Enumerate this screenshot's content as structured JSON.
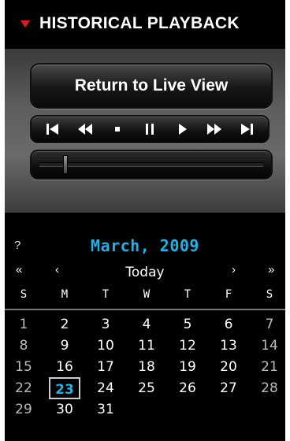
{
  "header": {
    "title": "HISTORICAL PLAYBACK"
  },
  "playback": {
    "return_label": "Return to Live View",
    "controls": [
      "skip-to-start-icon",
      "rewind-icon",
      "stop-icon",
      "pause-icon",
      "play-icon",
      "fast-forward-icon",
      "skip-to-end-icon"
    ]
  },
  "calendar": {
    "help": "?",
    "month_label": "March, 2009",
    "nav": {
      "prev_year": "«",
      "prev_month": "‹",
      "today": "Today",
      "next_month": "›",
      "next_year": "»"
    },
    "days_of_week": [
      "S",
      "M",
      "T",
      "W",
      "T",
      "F",
      "S"
    ],
    "weeks": [
      [
        "1",
        "2",
        "3",
        "4",
        "5",
        "6",
        "7"
      ],
      [
        "8",
        "9",
        "10",
        "11",
        "12",
        "13",
        "14"
      ],
      [
        "15",
        "16",
        "17",
        "18",
        "19",
        "20",
        "21"
      ],
      [
        "22",
        "23",
        "24",
        "25",
        "26",
        "27",
        "28"
      ],
      [
        "29",
        "30",
        "31",
        "",
        "",
        "",
        ""
      ]
    ],
    "selected_day": "23",
    "accent_color": "#1eb3e8"
  }
}
